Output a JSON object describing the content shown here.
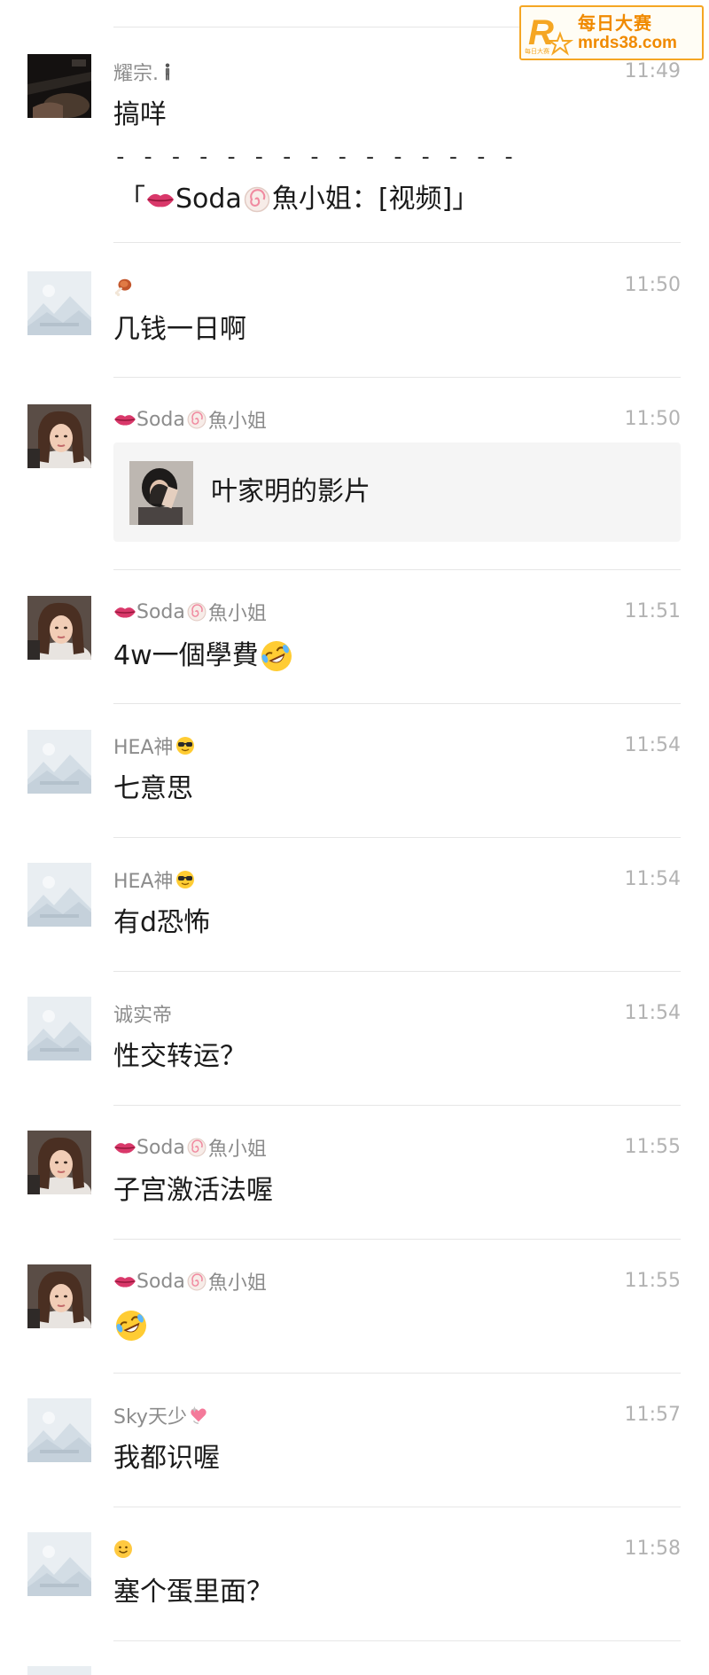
{
  "watermark": {
    "line1": "每日大赛",
    "line2": "mrds38.com",
    "logo_letter": "R",
    "logo_small": "每日大赛"
  },
  "messages": [
    {
      "sender": "耀宗.",
      "sender_emoji": "standing-person-icon",
      "time": "11:49",
      "text": "搞咩",
      "dashes": "- - - - - - - - - - - - - - -",
      "quote": {
        "open": "「",
        "name_a": "Soda",
        "name_b": "魚小姐",
        "colon": "：",
        "content": "[视频]",
        "close": "」"
      },
      "avatar": "photo-dark-car"
    },
    {
      "sender": "",
      "sender_emoji": "meat-on-bone-icon",
      "time": "11:50",
      "text": "几钱一日啊",
      "avatar": "placeholder-landscape"
    },
    {
      "sender_a": "Soda",
      "sender_b": "魚小姐",
      "time": "11:50",
      "card_title": "叶家明的影片",
      "avatar": "photo-girl"
    },
    {
      "sender_a": "Soda",
      "sender_b": "魚小姐",
      "time": "11:51",
      "text": "4w一個學費",
      "avatar": "photo-girl"
    },
    {
      "sender": "HEA神",
      "sender_emoji": "sunglasses-face-icon",
      "time": "11:54",
      "text": "七意思",
      "avatar": "placeholder-landscape"
    },
    {
      "sender": "HEA神",
      "sender_emoji": "sunglasses-face-icon",
      "time": "11:54",
      "text": "有d恐怖",
      "avatar": "placeholder-landscape"
    },
    {
      "sender": "诚实帝",
      "time": "11:54",
      "text": "性交转运？",
      "avatar": "placeholder-landscape"
    },
    {
      "sender_a": "Soda",
      "sender_b": "魚小姐",
      "time": "11:55",
      "text": "子宫激活法喔",
      "avatar": "photo-girl"
    },
    {
      "sender_a": "Soda",
      "sender_b": "魚小姐",
      "time": "11:55",
      "text": "",
      "text_emoji": "rolling-laughing-icon",
      "avatar": "photo-girl"
    },
    {
      "sender": "Sky天少",
      "sender_emoji": "sparkle-heart-icon",
      "time": "11:57",
      "text": "我都识喔",
      "avatar": "placeholder-landscape"
    },
    {
      "sender": "",
      "sender_emoji": "smiling-face-icon",
      "time": "11:58",
      "text": "塞个蛋里面？",
      "avatar": "placeholder-landscape"
    }
  ],
  "colors": {
    "time": "#b3b3b3",
    "sender": "#8c8c8c",
    "separator": "#e6e6e6",
    "card_bg": "#f5f5f5",
    "watermark": "#f08a00"
  }
}
